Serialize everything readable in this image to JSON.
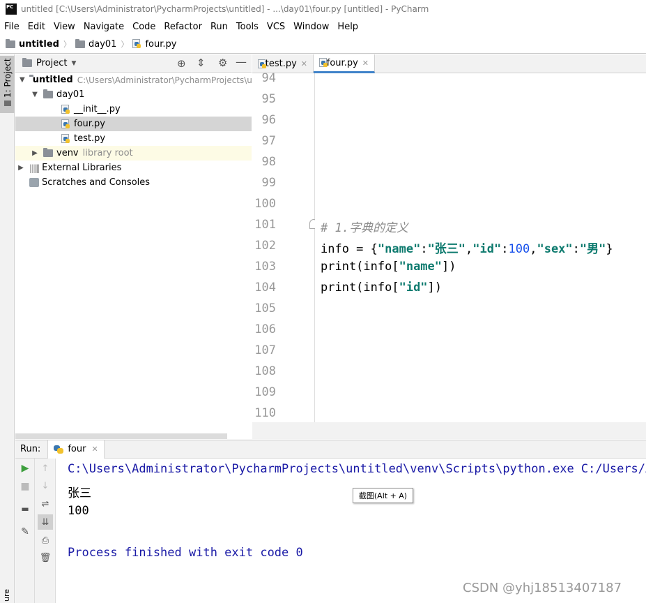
{
  "window": {
    "title": "untitled [C:\\Users\\Administrator\\PycharmProjects\\untitled] - ...\\day01\\four.py [untitled] - PyCharm",
    "logo_text": "PC"
  },
  "menu": [
    "File",
    "Edit",
    "View",
    "Navigate",
    "Code",
    "Refactor",
    "Run",
    "Tools",
    "VCS",
    "Window",
    "Help"
  ],
  "breadcrumb": {
    "project": "untitled",
    "folder": "day01",
    "file": "four.py"
  },
  "sidebar": {
    "project_tab": "1: Project",
    "structure_tab": "ure"
  },
  "project_panel": {
    "title": "Project",
    "root_name": "untitled",
    "root_path": "C:\\Users\\Administrator\\PycharmProjects\\u",
    "folder": "day01",
    "files": [
      "__init__.py",
      "four.py",
      "test.py"
    ],
    "venv": "venv",
    "venv_note": "library root",
    "external": "External Libraries",
    "scratches": "Scratches and Consoles"
  },
  "editor": {
    "tabs": [
      "test.py",
      "four.py"
    ],
    "line_numbers": [
      "94",
      "95",
      "96",
      "97",
      "98",
      "99",
      "100",
      "101",
      "102",
      "103",
      "104",
      "105",
      "106",
      "107",
      "108",
      "109",
      "110"
    ],
    "comment": "# 1.字典的定义",
    "line102": {
      "p1": "info = {",
      "k1": "\"name\"",
      "c1": ":",
      "v1": "\"张三\"",
      "c2": ",",
      "k2": "\"id\"",
      "c3": ":",
      "n1": "100",
      "c4": ",",
      "k3": "\"sex\"",
      "c5": ":",
      "v3": "\"男\"",
      "end": "}"
    },
    "line103": {
      "p1": "print(info[",
      "s": "\"name\"",
      "end": "])"
    },
    "line104": {
      "p1": "print(info[",
      "s": "\"id\"",
      "end": "])"
    }
  },
  "run": {
    "label": "Run:",
    "tab": "four",
    "output": [
      "C:\\Users\\Administrator\\PycharmProjects\\untitled\\venv\\Scripts\\python.exe C:/Users/Ad",
      "张三",
      "100",
      "",
      "Process finished with exit code 0"
    ]
  },
  "tooltip": "截图(Alt + A)",
  "watermark": "CSDN @yhj18513407187",
  "colors": {
    "string": "#0d7a6e",
    "number": "#1750eb",
    "comment": "#8c8c8c",
    "console_blue": "#1a1aa6"
  }
}
